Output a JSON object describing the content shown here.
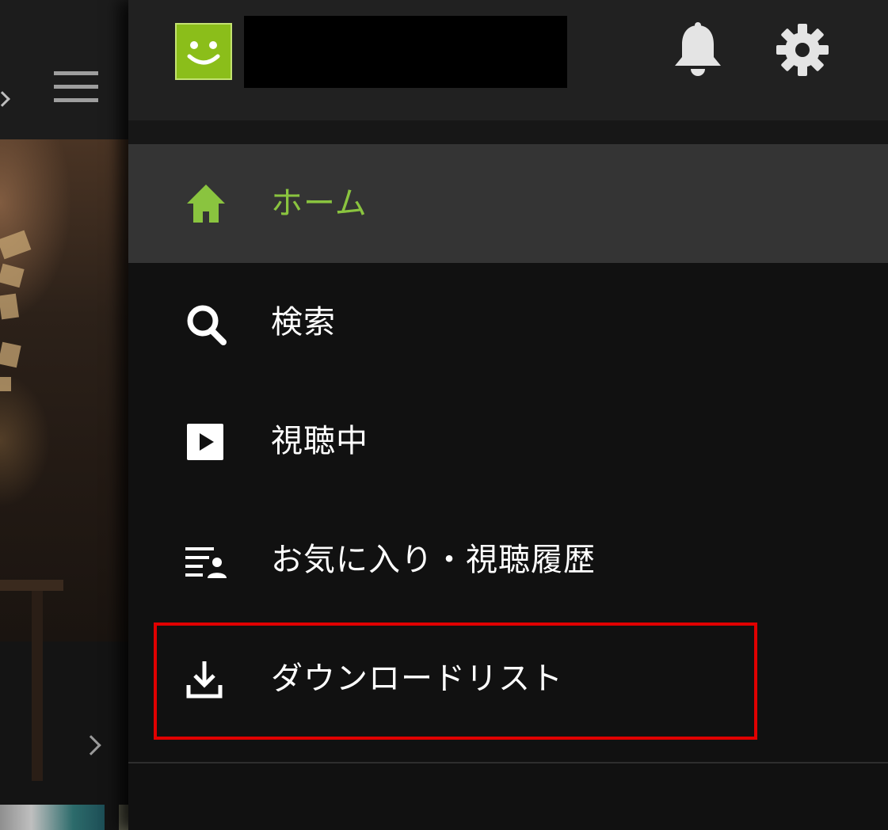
{
  "header": {
    "avatar_icon": "smiley-avatar-icon",
    "account_name": "",
    "notification_icon": "bell-icon",
    "settings_icon": "gear-icon"
  },
  "menu": {
    "items": [
      {
        "label": "ホーム",
        "icon": "home-icon",
        "active": true
      },
      {
        "label": "検索",
        "icon": "search-icon",
        "active": false
      },
      {
        "label": "視聴中",
        "icon": "play-icon",
        "active": false
      },
      {
        "label": "お気に入り・視聴履歴",
        "icon": "favorites-history-icon",
        "active": false
      },
      {
        "label": "ダウンロードリスト",
        "icon": "download-icon",
        "active": false,
        "highlighted": true
      }
    ]
  },
  "background_app": {
    "menu_icon": "hamburger-menu-icon",
    "back_icon": "chevron-left-icon",
    "next_icon": "chevron-right-icon"
  },
  "colors": {
    "accent": "#8ac43f",
    "avatar": "#8bbe1a",
    "highlight": "#e00000",
    "drawer_bg": "#111111",
    "header_bg": "#212121",
    "active_item_bg": "#343434"
  }
}
